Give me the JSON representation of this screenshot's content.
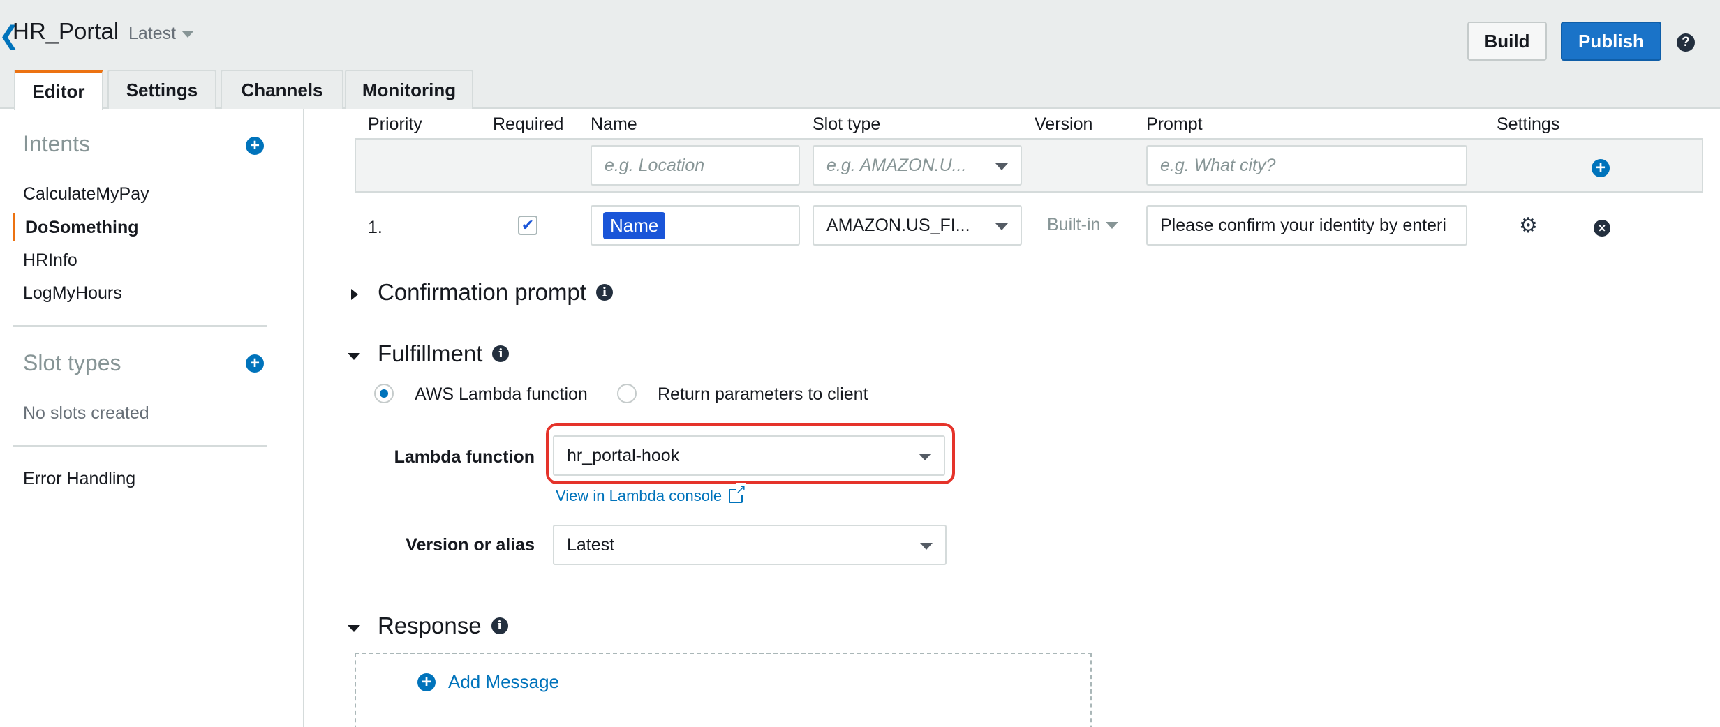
{
  "header": {
    "back_glyph": "❮",
    "bot_name": "HR_Portal",
    "version": "Latest",
    "build_label": "Build",
    "publish_label": "Publish",
    "help_glyph": "?"
  },
  "tabs": [
    {
      "label": "Editor",
      "active": true
    },
    {
      "label": "Settings",
      "active": false
    },
    {
      "label": "Channels",
      "active": false
    },
    {
      "label": "Monitoring",
      "active": false
    }
  ],
  "sidebar": {
    "intents_heading": "Intents",
    "intents": [
      "CalculateMyPay",
      "DoSomething",
      "HRInfo",
      "LogMyHours"
    ],
    "active_intent": "DoSomething",
    "slot_types_heading": "Slot types",
    "no_slots_text": "No slots created",
    "error_handling": "Error Handling"
  },
  "slots": {
    "columns": [
      "Priority",
      "Required",
      "Name",
      "Slot type",
      "Version",
      "Prompt",
      "Settings"
    ],
    "new_row": {
      "name_placeholder": "e.g. Location",
      "type_placeholder": "e.g. AMAZON.U...",
      "prompt_placeholder": "e.g. What city?"
    },
    "rows": [
      {
        "priority": "1.",
        "required": true,
        "check_glyph": "✔",
        "name": "Name",
        "slot_type": "AMAZON.US_FI...",
        "version": "Built-in",
        "prompt": "Please confirm your identity by enteri"
      }
    ]
  },
  "confirmation": {
    "title": "Confirmation prompt",
    "expanded": false
  },
  "fulfillment": {
    "title": "Fulfillment",
    "expanded": true,
    "options": [
      "AWS Lambda function",
      "Return parameters to client"
    ],
    "selected_option": "AWS Lambda function",
    "lambda_label": "Lambda function",
    "lambda_value": "hr_portal-hook",
    "view_link": "View in Lambda console",
    "alias_label": "Version or alias",
    "alias_value": "Latest"
  },
  "response": {
    "title": "Response",
    "expanded": true,
    "add_message": "Add Message"
  },
  "icons": {
    "plus": "+",
    "info": "i",
    "gear": "⚙",
    "close": "×"
  },
  "colors": {
    "accent_orange": "#ec7211",
    "primary_blue": "#1a73c8",
    "link_blue": "#0073bb",
    "highlight_red": "#e5332a"
  }
}
